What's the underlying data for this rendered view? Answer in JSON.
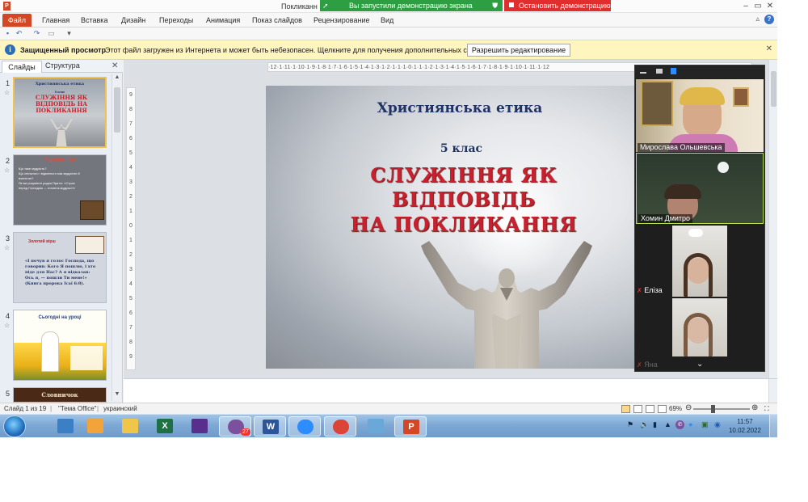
{
  "window": {
    "title": "Покликанн",
    "share_status": "Вы запустили демонстрацию экрана",
    "stop_share": "Остановить демонстрацию"
  },
  "ribbon": {
    "file": "Файл",
    "tabs": [
      "Главная",
      "Вставка",
      "Дизайн",
      "Переходы",
      "Анимация",
      "Показ слайдов",
      "Рецензирование",
      "Вид"
    ]
  },
  "protected_view": {
    "title": "Защищенный просмотр",
    "message": "Этот файл загружен из Интернета и может быть небезопасен. Щелкните для получения дополнительных сведений.",
    "button": "Разрешить редактирование"
  },
  "left_panel": {
    "tab_slides": "Слайды",
    "tab_outline": "Структура",
    "thumbnails": [
      {
        "num": "1",
        "line1": "5 клас",
        "head": "СЛУЖІННЯ ЯК ВІДПОВІДЬ НА ПОКЛИКАННЯ",
        "title": "Християнська етика"
      },
      {
        "num": "2",
        "head": "Я думаю так:",
        "bullets": [
          "Що таке мудрість?",
          "Що спільного і відмінного між мудрістю й вченістю?",
          "Як ви розумієте рядки Притчі: «Страх перед Господом — початок мудрості»"
        ]
      },
      {
        "num": "3",
        "head": "Золотий вірш",
        "quote": "«І почув я голос Господа, що говорив: Кого Я пошлю, і хто піде для Нас? А я відказав: Ось я, — пошли Ти мене!» (Книга пророка Ісаї 6:8)."
      },
      {
        "num": "4",
        "head": "Сьогодні на уроці"
      },
      {
        "num": "5",
        "head": "Словничок"
      }
    ]
  },
  "ruler": {
    "horizontal": "·12·1·11·1·10·1·9·1·8·1·7·1·6·1·5·1·4·1·3·1·2·1·1·1·0·1·1·1·2·1·3·1·4·1·5·1·6·1·7·1·8·1·9·1·10·1·11·1·12",
    "vertical": [
      "9",
      "8",
      "7",
      "6",
      "5",
      "4",
      "3",
      "2",
      "1",
      "0",
      "1",
      "2",
      "3",
      "4",
      "5",
      "6",
      "7",
      "8",
      "9"
    ]
  },
  "slide": {
    "title": "Християнська етика",
    "grade": "5 клас",
    "heading_lines": [
      "СЛУЖІННЯ ЯК",
      "ВІДПОВІДЬ",
      "НА ПОКЛИКАННЯ"
    ]
  },
  "participants": [
    {
      "name": "Мирослава Ольшевська",
      "muted": false
    },
    {
      "name": "Хомин Дмитро",
      "muted": false
    },
    {
      "name": "Еліза",
      "muted": true
    },
    {
      "name": "Яна",
      "muted": true
    }
  ],
  "statusbar": {
    "slide_info": "Слайд 1 из 19",
    "theme": "\"Тема Office\"",
    "language": "украинский",
    "zoom": "69%"
  },
  "taskbar": {
    "time": "11:57",
    "date": "10.02.2022",
    "apps": [
      {
        "name": "file-manager",
        "color": "#3b7fc4",
        "label": ""
      },
      {
        "name": "eye-app",
        "color": "#f2a33a",
        "label": ""
      },
      {
        "name": "folder",
        "color": "#f0c64a",
        "label": ""
      },
      {
        "name": "excel",
        "color": "#1e7145",
        "label": "X"
      },
      {
        "name": "save-app",
        "color": "#5a2e8c",
        "label": ""
      },
      {
        "name": "viber",
        "color": "#7b519d",
        "label": ""
      },
      {
        "name": "word",
        "color": "#2b579a",
        "label": "W"
      },
      {
        "name": "zoom",
        "color": "#2d8cff",
        "label": ""
      },
      {
        "name": "chrome",
        "color": "#db4437",
        "label": ""
      },
      {
        "name": "paint",
        "color": "#6aa8d8",
        "label": ""
      },
      {
        "name": "powerpoint",
        "color": "#d24726",
        "label": "P"
      }
    ],
    "viber_badge": "27"
  }
}
